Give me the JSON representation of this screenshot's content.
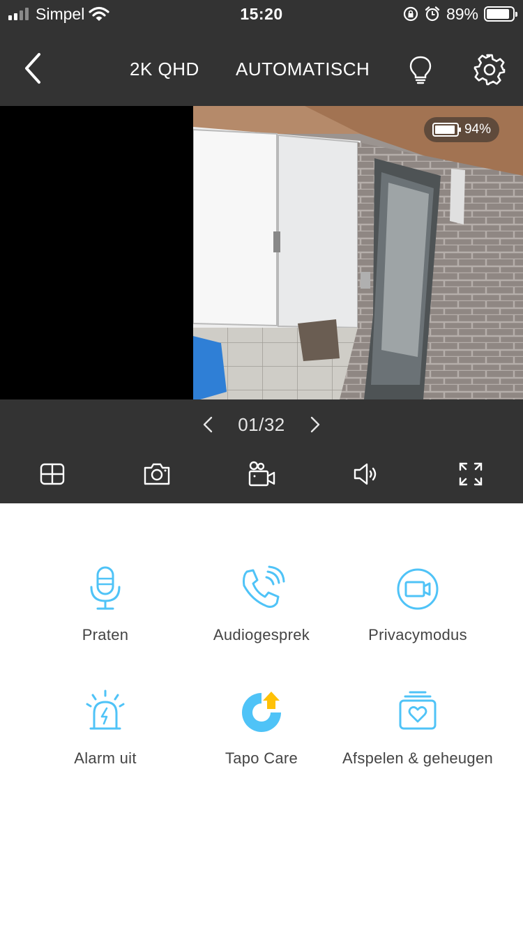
{
  "status_bar": {
    "carrier": "Simpel",
    "time": "15:20",
    "battery_percent": "89%",
    "battery_level": 0.89
  },
  "nav": {
    "resolution": "2K QHD",
    "mode": "AUTOMATISCH",
    "icons": [
      "back-chevron-icon",
      "lightbulb-icon",
      "gear-icon"
    ]
  },
  "camera": {
    "battery_percent": "94%",
    "battery_level": 0.94
  },
  "pager": {
    "page": "01/32"
  },
  "toolbar": {
    "icons": [
      "grid-layout-icon",
      "camera-snapshot-icon",
      "video-record-icon",
      "speaker-icon",
      "fullscreen-icon"
    ]
  },
  "features": [
    {
      "label": "Praten",
      "icon": "microphone-icon"
    },
    {
      "label": "Audiogesprek",
      "icon": "phone-call-icon"
    },
    {
      "label": "Privacymodus",
      "icon": "privacy-camera-icon"
    },
    {
      "label": "Alarm uit",
      "icon": "alarm-siren-icon"
    },
    {
      "label": "Tapo Care",
      "icon": "tapo-care-icon"
    },
    {
      "label": "Afspelen & geheugen",
      "icon": "playback-memory-icon"
    }
  ],
  "colors": {
    "header_bg": "#333333",
    "accent_blue": "#4fc3f7",
    "accent_yellow": "#ffc107"
  }
}
